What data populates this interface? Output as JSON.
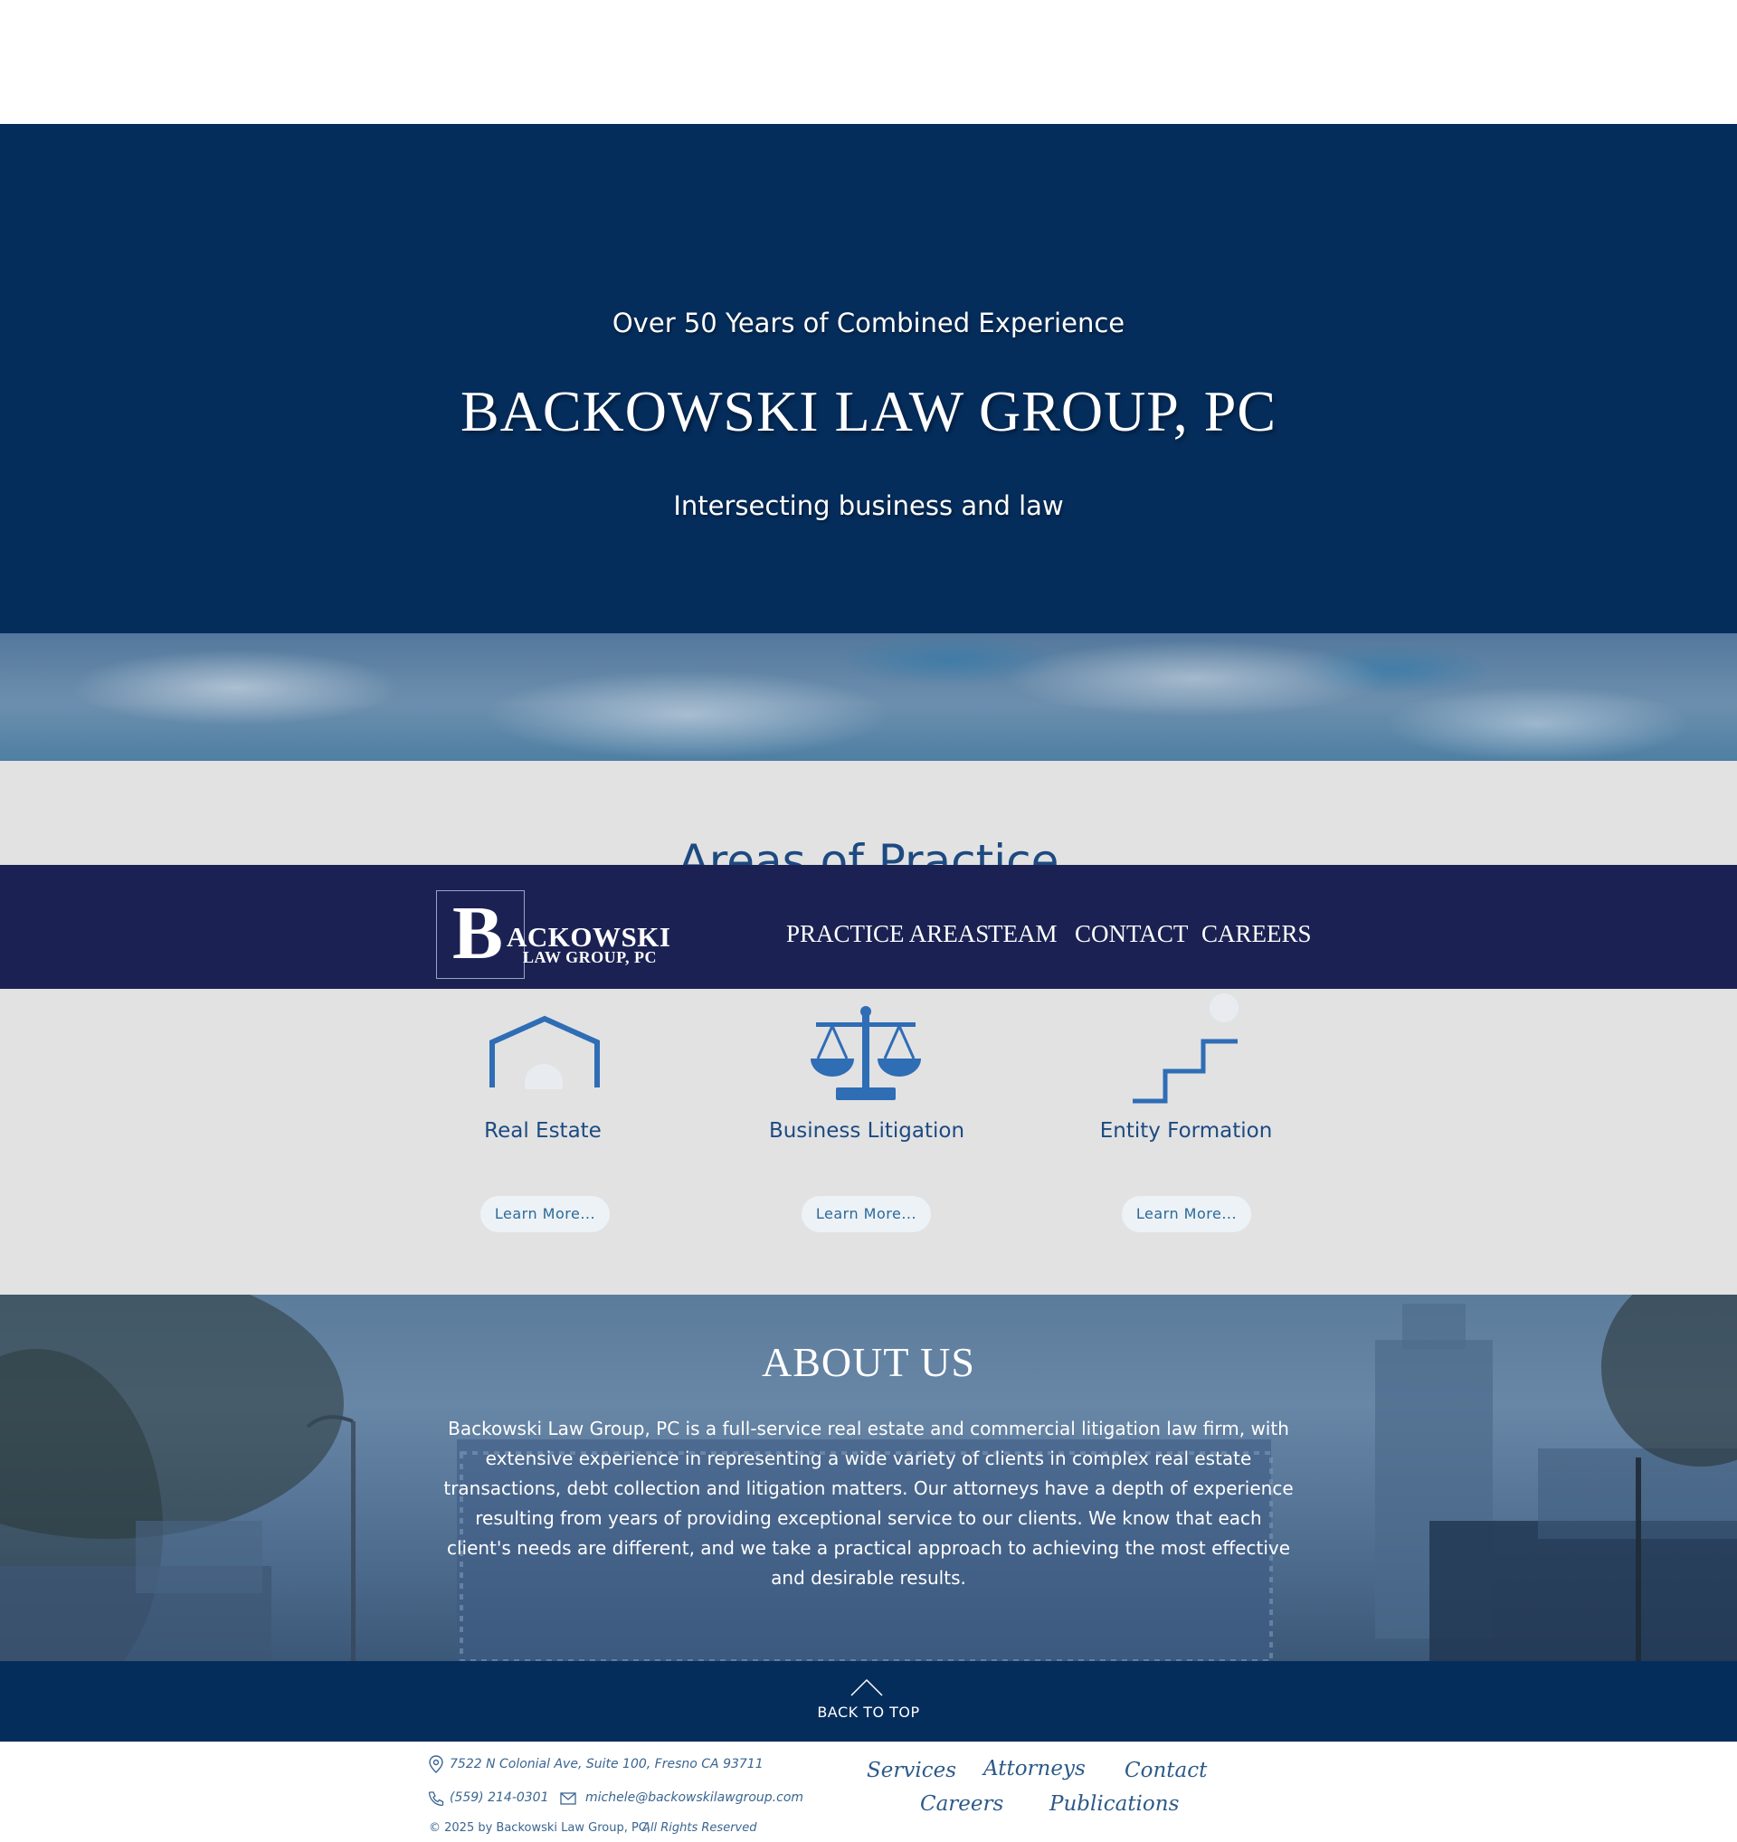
{
  "hero": {
    "kicker": "Over 50 Years of Combined Experience",
    "title": "BACKOWSKI LAW GROUP, PC",
    "tagline": "Intersecting business and law"
  },
  "practice": {
    "heading": "Areas of Practice",
    "cards": [
      {
        "title": "Real Estate",
        "button": "Learn More...",
        "icon": "house-outline-icon"
      },
      {
        "title": "Business Litigation",
        "button": "Learn More...",
        "icon": "scales-of-justice-icon"
      },
      {
        "title": "Entity Formation",
        "button": "Learn More...",
        "icon": "stairs-icon"
      }
    ]
  },
  "nav": {
    "logo_letter": "B",
    "logo_line1": "ACKOWSKI",
    "logo_line2": "LAW GROUP, PC",
    "items": [
      "PRACTICE AREAS",
      "TEAM",
      "CONTACT",
      "CAREERS"
    ]
  },
  "about": {
    "title": "ABOUT US",
    "body": "Backowski Law Group, PC is a full-service real estate and commercial litigation law firm, with extensive experience in representing a wide variety of clients in complex real estate transactions, debt collection and litigation matters.  Our attorneys have a depth of experience resulting from years of providing exceptional service to our clients.  We know that each client's needs are different, and we take a practical approach to achieving the most effective and desirable results."
  },
  "back_to_top": {
    "label": "BACK TO TOP",
    "icon": "chevron-up-icon"
  },
  "footer": {
    "address": "7522 N Colonial Ave, Suite 100, Fresno CA 93711",
    "phone": "(559) 214-0301",
    "email": "michele@backowskilawgroup.com",
    "copyright": "© 2025 by Backowski Law Group, PC,",
    "rights": "All Rights Reserved",
    "links": [
      "Services",
      "Attorneys",
      "Contact",
      "Careers",
      "Publications"
    ]
  },
  "colors": {
    "hero_bg": "#052d5c",
    "nav_bg": "#1b2253",
    "section_bg": "#e2e2e3",
    "accent_blue": "#2f6db5",
    "heading_blue": "#1d4a80"
  }
}
